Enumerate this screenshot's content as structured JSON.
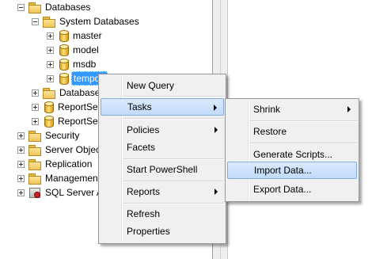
{
  "tree": {
    "databases": "Databases",
    "system_databases": "System Databases",
    "master": "master",
    "model": "model",
    "msdb": "msdb",
    "tempdb": "tempdb",
    "database_snapshots": "Databases",
    "report_server": "ReportSe",
    "report_server_temp": "ReportSe",
    "security": "Security",
    "server_objects": "Server Objec",
    "replication": "Replication",
    "management": "Managemen",
    "sql_server_agent": "SQL Server A"
  },
  "context_menu": {
    "new_query": "New Query",
    "tasks": "Tasks",
    "policies": "Policies",
    "facets": "Facets",
    "start_powershell": "Start PowerShell",
    "reports": "Reports",
    "refresh": "Refresh",
    "properties": "Properties"
  },
  "tasks_submenu": {
    "shrink": "Shrink",
    "restore": "Restore",
    "generate_scripts": "Generate Scripts...",
    "import_data": "Import Data...",
    "export_data": "Export Data..."
  },
  "colors": {
    "selection": "#3399ff",
    "menu_background": "#f0f0f0",
    "menu_highlight": "#c0dbfa",
    "menu_highlight_border": "#84acdd"
  }
}
